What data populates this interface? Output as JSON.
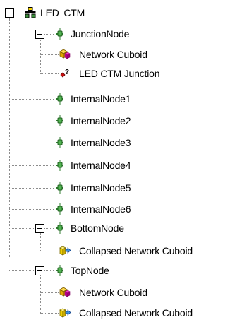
{
  "tree": {
    "root": {
      "label": "LED  CTM",
      "icon": "assembly-icon",
      "expanded": true
    },
    "junction_node": {
      "label": "JunctionNode",
      "icon": "node-icon",
      "expanded": true,
      "children": [
        {
          "label": "Network Cuboid",
          "icon": "network-cuboid-icon"
        },
        {
          "label": "LED  CTM Junction",
          "icon": "junction-question-icon"
        }
      ]
    },
    "internal_nodes": [
      {
        "label": "InternalNode1",
        "icon": "node-icon"
      },
      {
        "label": "InternalNode2",
        "icon": "node-icon"
      },
      {
        "label": "InternalNode3",
        "icon": "node-icon"
      },
      {
        "label": "InternalNode4",
        "icon": "node-icon"
      },
      {
        "label": "InternalNode5",
        "icon": "node-icon"
      },
      {
        "label": "InternalNode6",
        "icon": "node-icon"
      }
    ],
    "bottom_node": {
      "label": "BottomNode",
      "icon": "node-icon",
      "expanded": true,
      "children": [
        {
          "label": "Collapsed Network Cuboid",
          "icon": "collapsed-cuboid-icon"
        }
      ]
    },
    "top_node": {
      "label": "TopNode",
      "icon": "node-icon",
      "expanded": true,
      "children": [
        {
          "label": "Network Cuboid",
          "icon": "network-cuboid-icon"
        },
        {
          "label": "Collapsed Network Cuboid",
          "icon": "collapsed-cuboid-icon"
        }
      ]
    }
  }
}
